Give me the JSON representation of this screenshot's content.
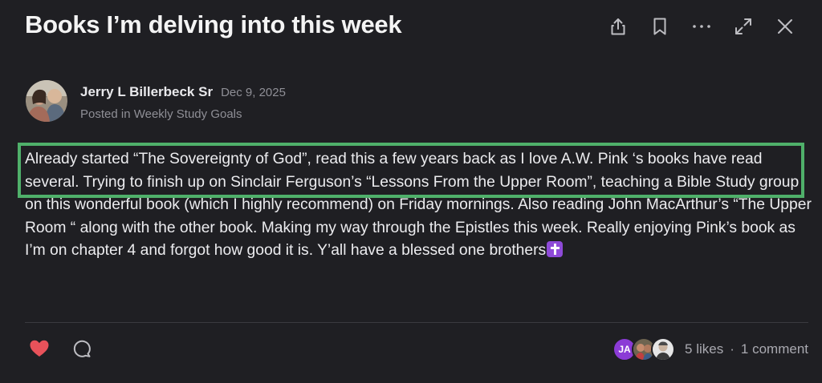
{
  "post": {
    "title": "Books I’m delving into this week",
    "author_name": "Jerry L Billerbeck Sr",
    "date": "Dec 9, 2025",
    "posted_in_prefix": "Posted in ",
    "group_name": "Weekly Study Goals",
    "body": "Already started “The Sovereignty of God”, read this a few years back as I love A.W. Pink ‘s books have read several. Trying to finish up on Sinclair Ferguson’s “Lessons From the Upper Room”, teaching a Bible Study group on this wonderful book (which I highly recommend) on Friday mornings. Also reading John MacArthur’s “The Upper  Room “ along with the other book. Making my way through the Epistles this week. Really enjoying Pink’s book as I’m on chapter 4 and forgot how good it is. Y’all have a blessed one brothers"
  },
  "toolbar": {
    "share_icon": "share-icon",
    "bookmark_icon": "bookmark-icon",
    "more_icon": "more-icon",
    "expand_icon": "expand-icon",
    "close_icon": "close-icon"
  },
  "reactions": {
    "liked": true,
    "like_color": "#e8525a",
    "facepile_initials": "JA",
    "likes_text": "5 likes",
    "separator": "·",
    "comments_text": "1 comment"
  },
  "colors": {
    "background": "#1f1f23",
    "highlight_border": "#4fb06a",
    "emoji_purple": "#8e4ad8"
  }
}
